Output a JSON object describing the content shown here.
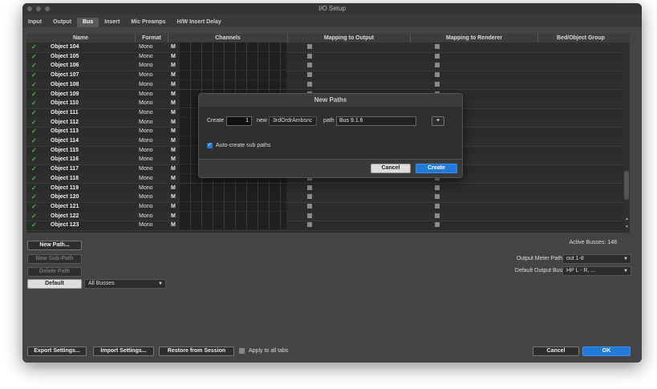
{
  "window": {
    "title": "I/O Setup"
  },
  "tabs": [
    "Input",
    "Output",
    "Bus",
    "Insert",
    "Mic Preamps",
    "H/W Insert Delay"
  ],
  "active_tab": "Bus",
  "table": {
    "headers": {
      "name": "Name",
      "format": "Format",
      "channels": "Channels",
      "mapping_output": "Mapping to Output",
      "mapping_renderer": "Mapping to Renderer",
      "bed_group": "Bed/Object Group"
    },
    "rows": [
      {
        "name": "Object  104",
        "format": "Mono",
        "m": "M"
      },
      {
        "name": "Object  105",
        "format": "Mono",
        "m": "M"
      },
      {
        "name": "Object  106",
        "format": "Mono",
        "m": "M"
      },
      {
        "name": "Object  107",
        "format": "Mono",
        "m": "M"
      },
      {
        "name": "Object  108",
        "format": "Mono",
        "m": "M"
      },
      {
        "name": "Object  109",
        "format": "Mono",
        "m": "M"
      },
      {
        "name": "Object  110",
        "format": "Mono",
        "m": "M"
      },
      {
        "name": "Object  111",
        "format": "Mono",
        "m": "M"
      },
      {
        "name": "Object  112",
        "format": "Mono",
        "m": "M"
      },
      {
        "name": "Object  113",
        "format": "Mono",
        "m": "M"
      },
      {
        "name": "Object  114",
        "format": "Mono",
        "m": "M"
      },
      {
        "name": "Object  115",
        "format": "Mono",
        "m": "M"
      },
      {
        "name": "Object  116",
        "format": "Mono",
        "m": "M"
      },
      {
        "name": "Object  117",
        "format": "Mono",
        "m": "M"
      },
      {
        "name": "Object  118",
        "format": "Mono",
        "m": "M"
      },
      {
        "name": "Object  119",
        "format": "Mono",
        "m": "M"
      },
      {
        "name": "Object  120",
        "format": "Mono",
        "m": "M"
      },
      {
        "name": "Object  121",
        "format": "Mono",
        "m": "M"
      },
      {
        "name": "Object  122",
        "format": "Mono",
        "m": "M"
      },
      {
        "name": "Object  123",
        "format": "Mono",
        "m": "M"
      }
    ]
  },
  "left_buttons": {
    "new_path": "New Path...",
    "new_sub_path": "New Sub-Path",
    "delete_path": "Delete Path",
    "default": "Default",
    "filter": "All Busses"
  },
  "right_info": {
    "active_busses": "Active Busses: 148",
    "output_meter_label": "Output Meter Path:",
    "output_meter_value": "out 1-8",
    "default_output_label": "Default Output Bus:",
    "default_output_value": "HP L - R, ..."
  },
  "footer": {
    "export": "Export Settings...",
    "import": "Import Settings...",
    "restore": "Restore from Session",
    "apply_all": "Apply to all tabs",
    "cancel": "Cancel",
    "ok": "OK"
  },
  "dialog": {
    "title": "New Paths",
    "create_label": "Create",
    "count": "1",
    "new_label": "new",
    "format_value": "3rdOrdrAmbsnc",
    "path_label": "path",
    "path_value": "Bus 9.1.6",
    "add": "+",
    "auto_create": "Auto-create sub paths",
    "cancel": "Cancel",
    "create": "Create"
  }
}
